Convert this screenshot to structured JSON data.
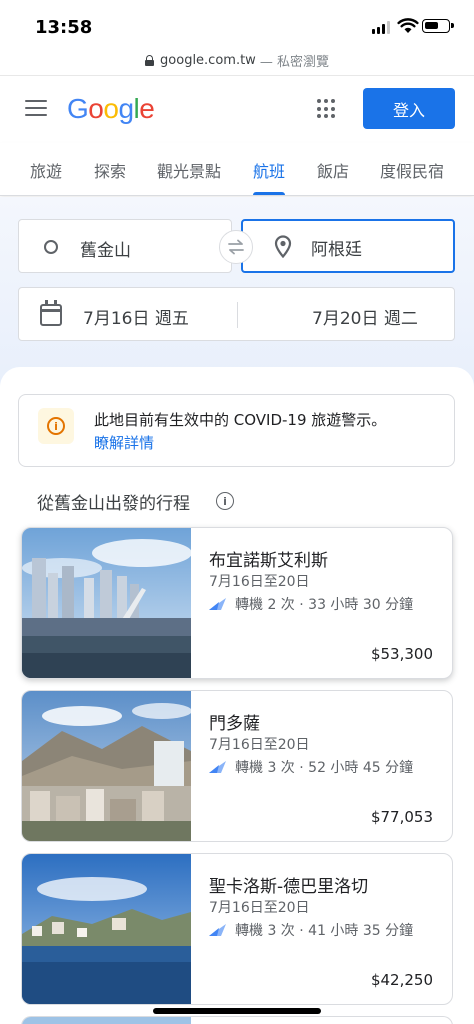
{
  "status": {
    "time": "13:58"
  },
  "browser": {
    "url": "google.com.tw",
    "mode": "— 私密瀏覽"
  },
  "header": {
    "sign_in": "登入"
  },
  "tabs": [
    {
      "label": "旅遊"
    },
    {
      "label": "探索"
    },
    {
      "label": "觀光景點"
    },
    {
      "label": "航班"
    },
    {
      "label": "飯店"
    },
    {
      "label": "度假民宿"
    }
  ],
  "active_tab": "航班",
  "search": {
    "origin": "舊金山",
    "destination": "阿根廷",
    "depart": "7月16日 週五",
    "return": "7月20日 週二"
  },
  "alert": {
    "message": "此地目前有生效中的 COVID-19 旅遊警示。",
    "link": "瞭解詳情"
  },
  "section_title": "從舊金山出發的行程",
  "results": [
    {
      "city": "布宜諾斯艾利斯",
      "dates": "7月16日至20日",
      "meta": "轉機 2 次 · 33 小時 30 分鐘",
      "price": "$53,300"
    },
    {
      "city": "門多薩",
      "dates": "7月16日至20日",
      "meta": "轉機 3 次 · 52 小時 45 分鐘",
      "price": "$77,053"
    },
    {
      "city": "聖卡洛斯-德巴里洛切",
      "dates": "7月16日至20日",
      "meta": "轉機 3 次 · 41 小時 35 分鐘",
      "price": "$42,250"
    }
  ],
  "colors": {
    "accent": "#1a73e8",
    "warning": "#e37400"
  }
}
